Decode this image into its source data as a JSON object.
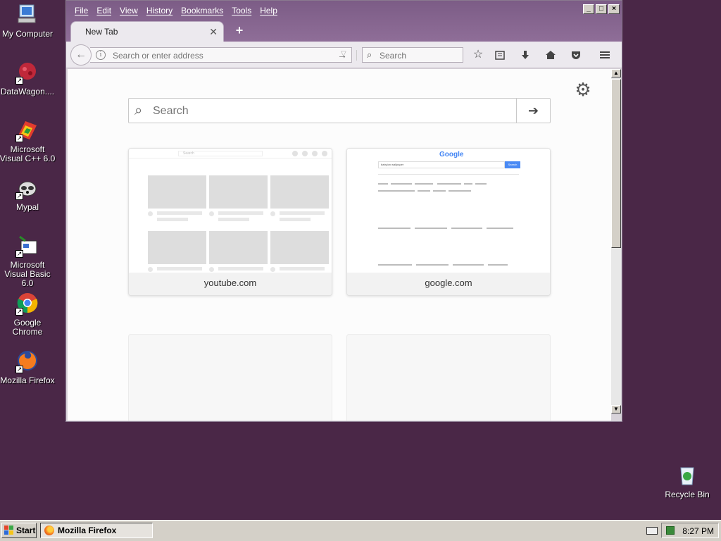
{
  "desktop": {
    "icons": [
      {
        "label": "My Computer",
        "icon": "computer-icon"
      },
      {
        "label": "DataWagon....",
        "icon": "datawagon-icon"
      },
      {
        "label": "Microsoft Visual C++ 6.0",
        "icon": "visual-cpp-icon"
      },
      {
        "label": "Mypal",
        "icon": "mypal-icon"
      },
      {
        "label": "Microsoft Visual Basic 6.0",
        "icon": "visual-basic-icon"
      },
      {
        "label": "Google Chrome",
        "icon": "chrome-icon"
      },
      {
        "label": "Mozilla Firefox",
        "icon": "firefox-icon"
      },
      {
        "label": "Recycle Bin",
        "icon": "recycle-bin-icon"
      }
    ]
  },
  "browser": {
    "menus": [
      "File",
      "Edit",
      "View",
      "History",
      "Bookmarks",
      "Tools",
      "Help"
    ],
    "window_buttons": [
      "_",
      "□",
      "×"
    ],
    "tab": {
      "title": "New Tab",
      "close": "✕"
    },
    "new_tab_symbol": "+",
    "urlbar": {
      "placeholder": "Search or enter address",
      "value": ""
    },
    "searchbar": {
      "placeholder": "Search"
    },
    "newtab_page": {
      "search_placeholder": "Search",
      "tiles": [
        {
          "caption": "youtube.com"
        },
        {
          "caption": "google.com"
        },
        {
          "caption": ""
        },
        {
          "caption": ""
        }
      ],
      "youtube_preview": {
        "search_text": "Search"
      },
      "google_preview": {
        "logo": "Google",
        "query": "babylon wallpaper",
        "button": "Search"
      }
    }
  },
  "taskbar": {
    "start_label": "Start",
    "task_label": "Mozilla Firefox",
    "clock": "8:27 PM"
  },
  "colors": {
    "desktop_bg": "#4a2747",
    "titlebar": "#8a6a94",
    "taskbar": "#d4d0c8"
  }
}
